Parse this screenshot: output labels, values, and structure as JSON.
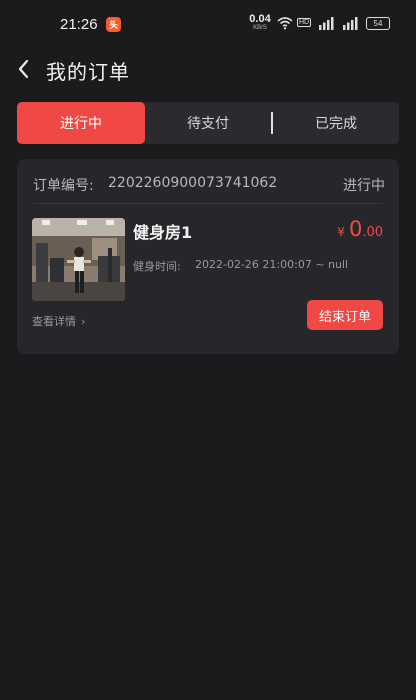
{
  "status_bar": {
    "time": "21:26",
    "app_badge": "头",
    "net_speed": "0.04",
    "net_unit": "KB/S",
    "hd_label": "HD",
    "battery": "54"
  },
  "header": {
    "title": "我的订单"
  },
  "tabs": [
    {
      "label": "进行中",
      "active": true
    },
    {
      "label": "待支付",
      "active": false
    },
    {
      "label": "已完成",
      "active": false
    }
  ],
  "order": {
    "number_label": "订单编号:",
    "number": "2202260900073741062",
    "status": "进行中",
    "gym_name": "健身房1",
    "currency": "¥",
    "price_int": "0",
    "price_dec": ".00",
    "time_label": "健身时间:",
    "time_value": "2022-02-26 21:00:07 ~ null",
    "detail_label": "查看详情",
    "end_button_label": "结束订单"
  },
  "colors": {
    "accent": "#f04845",
    "background": "#1b1b1e",
    "card": "#27272b"
  }
}
